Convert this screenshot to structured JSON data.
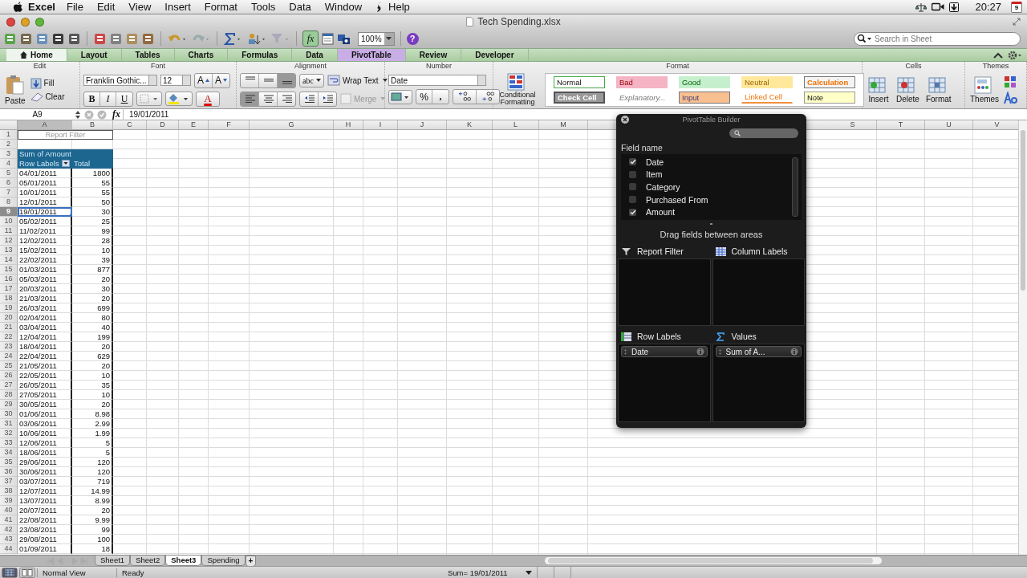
{
  "menubar": {
    "app": "Excel",
    "items": [
      "File",
      "Edit",
      "View",
      "Insert",
      "Format",
      "Tools",
      "Data",
      "Window",
      "Help"
    ],
    "clock": "20:27",
    "calendar_day": "9"
  },
  "window": {
    "title": "Tech Spending.xlsx"
  },
  "toolbar": {
    "formula_builder": "fx",
    "zoom": "100%",
    "help": "?",
    "search": {
      "placeholder": "Search in Sheet"
    }
  },
  "ribbon_tabs": [
    {
      "label": "Home",
      "selected": true,
      "kind": "standard"
    },
    {
      "label": "Layout",
      "selected": false,
      "kind": "standard"
    },
    {
      "label": "Tables",
      "selected": false,
      "kind": "standard"
    },
    {
      "label": "Charts",
      "selected": false,
      "kind": "standard"
    },
    {
      "label": "Formulas",
      "selected": false,
      "kind": "standard"
    },
    {
      "label": "Data",
      "selected": false,
      "kind": "standard"
    },
    {
      "label": "PivotTable",
      "selected": false,
      "kind": "contextual"
    },
    {
      "label": "Review",
      "selected": false,
      "kind": "standard"
    },
    {
      "label": "Developer",
      "selected": false,
      "kind": "standard"
    }
  ],
  "ribbon": {
    "edit": {
      "label": "Edit",
      "paste": "Paste",
      "fill": "Fill",
      "clear": "Clear"
    },
    "font": {
      "label": "Font",
      "name": "Franklin Gothic...",
      "size": "12",
      "grow": "A",
      "shrink": "A",
      "bold": "B",
      "italic": "I",
      "underline": "U",
      "text_color_button": "A"
    },
    "alignment": {
      "label": "Alignment",
      "valign": [
        {
          "selected": false
        },
        {
          "selected": false
        },
        {
          "selected": true
        }
      ],
      "halign": [
        {
          "selected": true
        },
        {
          "selected": false
        },
        {
          "selected": false
        }
      ],
      "orientation": "abc",
      "wrap": "Wrap Text",
      "merge": "Merge"
    },
    "number": {
      "label": "Number",
      "format": "Date",
      "percent": "%",
      "comma": ","
    },
    "format": {
      "label": "Format",
      "conditional": "Conditional Formatting",
      "styles": [
        {
          "label": "Normal",
          "kind": "normal"
        },
        {
          "label": "Bad",
          "kind": "bad"
        },
        {
          "label": "Good",
          "kind": "good"
        },
        {
          "label": "Neutral",
          "kind": "neutral"
        },
        {
          "label": "Calculation",
          "kind": "calculation"
        },
        {
          "label": "Check Cell",
          "kind": "check"
        },
        {
          "label": "Explanatory...",
          "kind": "explanatory"
        },
        {
          "label": "Input",
          "kind": "input"
        },
        {
          "label": "Linked Cell",
          "kind": "linked"
        },
        {
          "label": "Note",
          "kind": "note"
        }
      ]
    },
    "cells": {
      "label": "Cells",
      "buttons": [
        "Insert",
        "Delete",
        "Format"
      ]
    },
    "themes": {
      "label": "Themes",
      "button": "Themes"
    }
  },
  "formula_bar": {
    "name_box": "A9",
    "fx": "fx",
    "value": "19/01/2011"
  },
  "sheet": {
    "columns": [
      {
        "label": "A",
        "selected": true
      },
      {
        "label": "B",
        "selected": false
      },
      {
        "label": "C",
        "selected": false
      },
      {
        "label": "D",
        "selected": false
      },
      {
        "label": "E",
        "selected": false
      },
      {
        "label": "F",
        "selected": false
      },
      {
        "label": "G",
        "selected": false
      },
      {
        "label": "H",
        "selected": false
      },
      {
        "label": "I",
        "selected": false
      },
      {
        "label": "J",
        "selected": false
      },
      {
        "label": "K",
        "selected": false
      },
      {
        "label": "L",
        "selected": false
      },
      {
        "label": "M",
        "selected": false
      },
      {
        "label": "S",
        "selected": false
      },
      {
        "label": "T",
        "selected": false
      },
      {
        "label": "U",
        "selected": false
      },
      {
        "label": "V",
        "selected": false
      }
    ],
    "rows": [
      {
        "n": "1",
        "kind": "filter",
        "a": "Report Filter",
        "selected": false
      },
      {
        "n": "2",
        "kind": "blank",
        "selected": false
      },
      {
        "n": "3",
        "kind": "title",
        "a": "Sum of Amount",
        "selected": false
      },
      {
        "n": "4",
        "kind": "header",
        "a": "Row Labels",
        "b": "Total",
        "selected": false
      },
      {
        "n": "5",
        "kind": "data",
        "a": "04/01/2011",
        "b": "1800",
        "selected": false
      },
      {
        "n": "6",
        "kind": "data",
        "a": "05/01/2011",
        "b": "55",
        "selected": false
      },
      {
        "n": "7",
        "kind": "data",
        "a": "10/01/2011",
        "b": "55",
        "selected": false
      },
      {
        "n": "8",
        "kind": "data",
        "a": "12/01/2011",
        "b": "50",
        "selected": false
      },
      {
        "n": "9",
        "kind": "data",
        "a": "19/01/2011",
        "b": "30",
        "selected": true
      },
      {
        "n": "10",
        "kind": "data",
        "a": "05/02/2011",
        "b": "25",
        "selected": false
      },
      {
        "n": "11",
        "kind": "data",
        "a": "11/02/2011",
        "b": "99",
        "selected": false
      },
      {
        "n": "12",
        "kind": "data",
        "a": "12/02/2011",
        "b": "28",
        "selected": false
      },
      {
        "n": "13",
        "kind": "data",
        "a": "15/02/2011",
        "b": "10",
        "selected": false
      },
      {
        "n": "14",
        "kind": "data",
        "a": "22/02/2011",
        "b": "39",
        "selected": false
      },
      {
        "n": "15",
        "kind": "data",
        "a": "01/03/2011",
        "b": "877",
        "selected": false
      },
      {
        "n": "16",
        "kind": "data",
        "a": "05/03/2011",
        "b": "20",
        "selected": false
      },
      {
        "n": "17",
        "kind": "data",
        "a": "20/03/2011",
        "b": "30",
        "selected": false
      },
      {
        "n": "18",
        "kind": "data",
        "a": "21/03/2011",
        "b": "20",
        "selected": false
      },
      {
        "n": "19",
        "kind": "data",
        "a": "26/03/2011",
        "b": "699",
        "selected": false
      },
      {
        "n": "20",
        "kind": "data",
        "a": "02/04/2011",
        "b": "80",
        "selected": false
      },
      {
        "n": "21",
        "kind": "data",
        "a": "03/04/2011",
        "b": "40",
        "selected": false
      },
      {
        "n": "22",
        "kind": "data",
        "a": "12/04/2011",
        "b": "199",
        "selected": false
      },
      {
        "n": "23",
        "kind": "data",
        "a": "18/04/2011",
        "b": "20",
        "selected": false
      },
      {
        "n": "24",
        "kind": "data",
        "a": "22/04/2011",
        "b": "629",
        "selected": false
      },
      {
        "n": "25",
        "kind": "data",
        "a": "21/05/2011",
        "b": "20",
        "selected": false
      },
      {
        "n": "26",
        "kind": "data",
        "a": "22/05/2011",
        "b": "10",
        "selected": false
      },
      {
        "n": "27",
        "kind": "data",
        "a": "26/05/2011",
        "b": "35",
        "selected": false
      },
      {
        "n": "28",
        "kind": "data",
        "a": "27/05/2011",
        "b": "10",
        "selected": false
      },
      {
        "n": "29",
        "kind": "data",
        "a": "30/05/2011",
        "b": "20",
        "selected": false
      },
      {
        "n": "30",
        "kind": "data",
        "a": "01/06/2011",
        "b": "8.98",
        "selected": false
      },
      {
        "n": "31",
        "kind": "data",
        "a": "03/06/2011",
        "b": "2.99",
        "selected": false
      },
      {
        "n": "32",
        "kind": "data",
        "a": "10/06/2011",
        "b": "1.99",
        "selected": false
      },
      {
        "n": "33",
        "kind": "data",
        "a": "12/06/2011",
        "b": "5",
        "selected": false
      },
      {
        "n": "34",
        "kind": "data",
        "a": "18/06/2011",
        "b": "5",
        "selected": false
      },
      {
        "n": "35",
        "kind": "data",
        "a": "29/06/2011",
        "b": "120",
        "selected": false
      },
      {
        "n": "36",
        "kind": "data",
        "a": "30/06/2011",
        "b": "120",
        "selected": false
      },
      {
        "n": "37",
        "kind": "data",
        "a": "03/07/2011",
        "b": "719",
        "selected": false
      },
      {
        "n": "38",
        "kind": "data",
        "a": "12/07/2011",
        "b": "14.99",
        "selected": false
      },
      {
        "n": "39",
        "kind": "data",
        "a": "13/07/2011",
        "b": "8.99",
        "selected": false
      },
      {
        "n": "40",
        "kind": "data",
        "a": "20/07/2011",
        "b": "20",
        "selected": false
      },
      {
        "n": "41",
        "kind": "data",
        "a": "22/08/2011",
        "b": "9.99",
        "selected": false
      },
      {
        "n": "42",
        "kind": "data",
        "a": "23/08/2011",
        "b": "99",
        "selected": false
      },
      {
        "n": "43",
        "kind": "data",
        "a": "29/08/2011",
        "b": "100",
        "selected": false
      },
      {
        "n": "44",
        "kind": "data",
        "a": "01/09/2011",
        "b": "18",
        "selected": false
      }
    ]
  },
  "pivot_builder": {
    "title": "PivotTable Builder",
    "field_header": "Field name",
    "fields": [
      {
        "label": "Date",
        "checked": true
      },
      {
        "label": "Item",
        "checked": false
      },
      {
        "label": "Category",
        "checked": false
      },
      {
        "label": "Purchased From",
        "checked": false
      },
      {
        "label": "Amount",
        "checked": true
      }
    ],
    "hint": "Drag fields between areas",
    "areas": [
      {
        "label": "Report Filter",
        "kind": "filter"
      },
      {
        "label": "Column Labels",
        "kind": "columns"
      },
      {
        "label": "Row Labels",
        "kind": "rows",
        "items": [
          "Date"
        ]
      },
      {
        "label": "Values",
        "kind": "values",
        "items": [
          "Sum of A..."
        ]
      }
    ]
  },
  "sheet_tabs": [
    {
      "label": "Sheet1",
      "selected": false
    },
    {
      "label": "Sheet2",
      "selected": false
    },
    {
      "label": "Sheet3",
      "selected": true
    },
    {
      "label": "Spending",
      "selected": false
    }
  ],
  "add_sheet": "+",
  "status_bar": {
    "view": "Normal View",
    "mode": "Ready",
    "sum": "Sum= 19/01/2011"
  }
}
